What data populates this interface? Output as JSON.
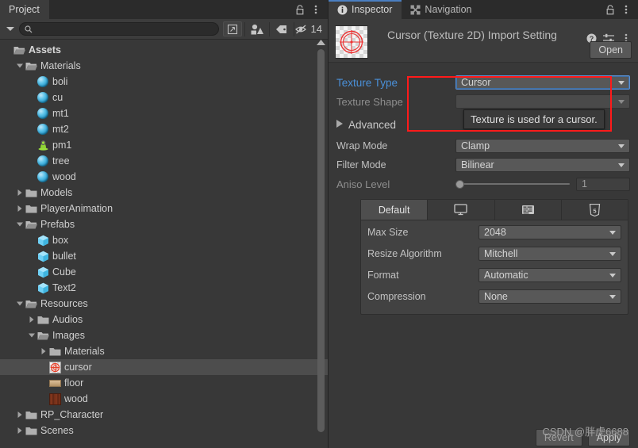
{
  "project_panel": {
    "tab_label": "Project",
    "lock_icon": "lock-icon",
    "menu_icon": "kebab-menu-icon",
    "toolbar": {
      "dropdown_icon": "chevron-down-icon",
      "search_placeholder": "",
      "search_value": "",
      "search_icon": "search-icon",
      "scene_search_icon": "search-in-scene-icon",
      "type_filter_icon": "asset-type-filter-icon",
      "label_filter_icon": "label-tag-icon",
      "hidden_icon": "hidden-eye-icon",
      "hidden_count": "14"
    },
    "tree": [
      {
        "label": "Assets",
        "indent": 0,
        "twisty": "none",
        "icon": "folder-open-icon",
        "bold": true
      },
      {
        "label": "Materials",
        "indent": 1,
        "twisty": "expanded",
        "icon": "folder-open-icon",
        "bold": false
      },
      {
        "label": "boli",
        "indent": 2,
        "twisty": "none",
        "icon": "material-sphere-icon",
        "bold": false
      },
      {
        "label": "cu",
        "indent": 2,
        "twisty": "none",
        "icon": "material-sphere-icon",
        "bold": false
      },
      {
        "label": "mt1",
        "indent": 2,
        "twisty": "none",
        "icon": "material-sphere-icon",
        "bold": false
      },
      {
        "label": "mt2",
        "indent": 2,
        "twisty": "none",
        "icon": "material-sphere-icon",
        "bold": false
      },
      {
        "label": "pm1",
        "indent": 2,
        "twisty": "none",
        "icon": "physic-material-icon",
        "bold": false
      },
      {
        "label": "tree",
        "indent": 2,
        "twisty": "none",
        "icon": "material-sphere-icon",
        "bold": false
      },
      {
        "label": "wood",
        "indent": 2,
        "twisty": "none",
        "icon": "material-sphere-icon",
        "bold": false
      },
      {
        "label": "Models",
        "indent": 1,
        "twisty": "collapsed",
        "icon": "folder-closed-icon",
        "bold": false
      },
      {
        "label": "PlayerAnimation",
        "indent": 1,
        "twisty": "collapsed",
        "icon": "folder-closed-icon",
        "bold": false
      },
      {
        "label": "Prefabs",
        "indent": 1,
        "twisty": "expanded",
        "icon": "folder-open-icon",
        "bold": false
      },
      {
        "label": "box",
        "indent": 2,
        "twisty": "none",
        "icon": "prefab-cube-icon",
        "bold": false
      },
      {
        "label": "bullet",
        "indent": 2,
        "twisty": "none",
        "icon": "prefab-cube-icon",
        "bold": false
      },
      {
        "label": "Cube",
        "indent": 2,
        "twisty": "none",
        "icon": "prefab-cube-icon",
        "bold": false
      },
      {
        "label": "Text2",
        "indent": 2,
        "twisty": "none",
        "icon": "prefab-cube-icon",
        "bold": false
      },
      {
        "label": "Resources",
        "indent": 1,
        "twisty": "expanded",
        "icon": "folder-open-icon",
        "bold": false
      },
      {
        "label": "Audios",
        "indent": 2,
        "twisty": "collapsed",
        "icon": "folder-closed-icon",
        "bold": false
      },
      {
        "label": "Images",
        "indent": 2,
        "twisty": "expanded",
        "icon": "folder-open-icon",
        "bold": false
      },
      {
        "label": "Materials",
        "indent": 3,
        "twisty": "collapsed",
        "icon": "folder-closed-icon",
        "bold": false
      },
      {
        "label": "cursor",
        "indent": 3,
        "twisty": "none",
        "icon": "cursor-texture-icon",
        "bold": false,
        "selected": true
      },
      {
        "label": "floor",
        "indent": 3,
        "twisty": "none",
        "icon": "floor-texture-icon",
        "bold": false
      },
      {
        "label": "wood",
        "indent": 3,
        "twisty": "none",
        "icon": "wood-texture-icon",
        "bold": false
      },
      {
        "label": "RP_Character",
        "indent": 1,
        "twisty": "collapsed",
        "icon": "folder-closed-icon",
        "bold": false
      },
      {
        "label": "Scenes",
        "indent": 1,
        "twisty": "collapsed",
        "icon": "folder-closed-icon",
        "bold": false
      }
    ]
  },
  "inspector_panel": {
    "tabs": [
      {
        "label": "Inspector",
        "icon": "info-icon",
        "active": true
      },
      {
        "label": "Navigation",
        "icon": "navigation-icon",
        "active": false
      }
    ],
    "lock_icon": "lock-icon",
    "menu_icon": "kebab-menu-icon",
    "asset": {
      "title": "Cursor (Texture 2D) Import Settinɡ",
      "thumb_icon": "cursor-reticle-icon",
      "help_icon": "help-question-icon",
      "preset_icon": "preset-sliders-icon",
      "more_icon": "kebab-menu-icon",
      "open_label": "Open"
    },
    "fields": {
      "texture_type_label": "Texture Type",
      "texture_type_value": "Cursor",
      "texture_shape_label": "Texture Shape",
      "texture_shape_value": "",
      "advanced_label": "Advanced",
      "wrap_mode_label": "Wrap Mode",
      "wrap_mode_value": "Clamp",
      "filter_mode_label": "Filter Mode",
      "filter_mode_value": "Bilinear",
      "aniso_level_label": "Aniso Level",
      "aniso_level_value": "1"
    },
    "tooltip": "Texture is used for a cursor.",
    "platform": {
      "tabs": [
        {
          "label": "Default",
          "icon": "",
          "active": true
        },
        {
          "label": "",
          "icon": "standalone-monitor-icon",
          "active": false
        },
        {
          "label": "",
          "icon": "android-icon",
          "active": false
        },
        {
          "label": "",
          "icon": "webgl-html5-icon",
          "active": false
        }
      ],
      "rows": [
        {
          "label": "Max Size",
          "value": "2048"
        },
        {
          "label": "Resize Algorithm",
          "value": "Mitchell"
        },
        {
          "label": "Format",
          "value": "Automatic"
        },
        {
          "label": "Compression",
          "value": "None"
        }
      ]
    },
    "actions": {
      "revert_label": "Revert",
      "apply_label": "Apply"
    },
    "watermark": "CSDN @胖虎6688"
  },
  "colors": {
    "accent_blue": "#4a90d9",
    "annotation_red": "#ff1a1a",
    "panel_bg": "#383838",
    "tab_bg": "#2b2b2b"
  }
}
